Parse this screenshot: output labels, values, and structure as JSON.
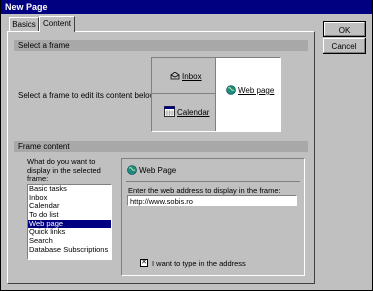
{
  "window": {
    "title": "New Page"
  },
  "tabs": [
    {
      "label": "Basics"
    },
    {
      "label": "Content"
    }
  ],
  "buttons": {
    "ok": "OK",
    "cancel": "Cancel"
  },
  "select_frame": {
    "header": "Select a frame",
    "instruction": "Select a frame to edit its content below.",
    "frames": {
      "inbox": "Inbox",
      "calendar": "Calendar",
      "web_page": "Web page"
    }
  },
  "frame_content": {
    "header": "Frame content",
    "question": "What do you want to display in the selected frame:",
    "items": [
      "Basic tasks",
      "Inbox",
      "Calendar",
      "To do list",
      "Web page",
      "Quick links",
      "Search",
      "Database Subscriptions"
    ],
    "selected_index": 4,
    "web_page_panel": {
      "title": "Web Page",
      "address_label": "Enter the web address to display in the frame:",
      "address_value": "http://www.sobis.ro",
      "checkbox_label": "I want to type in the address",
      "checkbox_checked": true
    }
  }
}
